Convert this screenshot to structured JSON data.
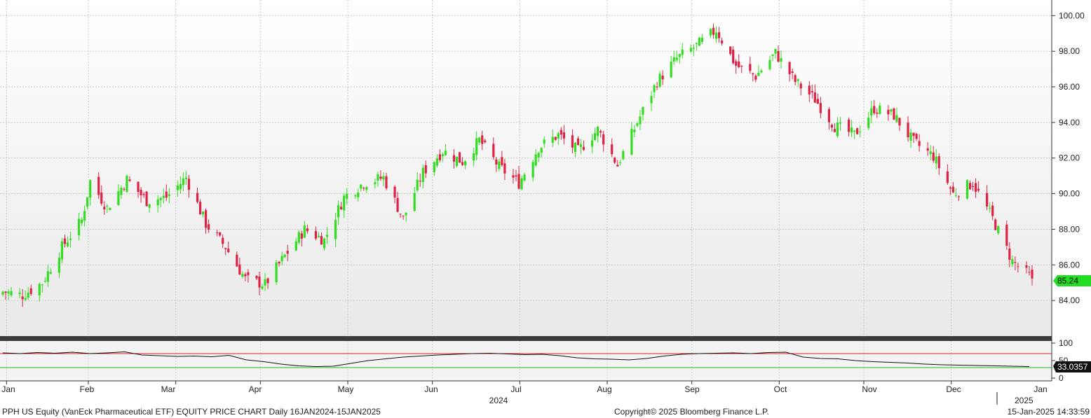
{
  "chart_data": {
    "type": "candlestick",
    "title": "PPH US Equity (VanEck Pharmaceutical ETF) EQUITY PRICE CHART  Daily 16JAN2024-15JAN2025",
    "frequency": "Daily",
    "period": "16JAN2024-15JAN2025",
    "year_label": "2024",
    "year_label_2": "2025",
    "x_tick_labels": [
      "Jan",
      "Feb",
      "Mar",
      "Apr",
      "May",
      "Jun",
      "Jul",
      "Aug",
      "Sep",
      "Oct",
      "Nov",
      "Dec",
      "Jan"
    ],
    "price_panel": {
      "ylim": [
        82.0,
        100.8
      ],
      "y_ticks": [
        "84.00",
        "86.00",
        "88.00",
        "90.00",
        "92.00",
        "94.00",
        "96.00",
        "98.00",
        "100.00"
      ],
      "last_price_label": "85.24",
      "last_price": 85.24,
      "grid": true,
      "up_color": "#33dd22",
      "down_color": "#dd2244",
      "series": [
        {
          "date": "2024-01-16",
          "close": 84.5
        },
        {
          "date": "2024-01-23",
          "close": 84.3
        },
        {
          "date": "2024-01-30",
          "close": 85.0
        },
        {
          "date": "2024-02-06",
          "close": 87.0
        },
        {
          "date": "2024-02-13",
          "close": 88.5
        },
        {
          "date": "2024-02-16",
          "close": 90.7
        },
        {
          "date": "2024-02-22",
          "close": 89.2
        },
        {
          "date": "2024-02-29",
          "close": 90.8
        },
        {
          "date": "2024-03-07",
          "close": 89.6
        },
        {
          "date": "2024-03-14",
          "close": 89.8
        },
        {
          "date": "2024-03-21",
          "close": 90.9
        },
        {
          "date": "2024-03-28",
          "close": 88.3
        },
        {
          "date": "2024-04-04",
          "close": 87.0
        },
        {
          "date": "2024-04-11",
          "close": 85.2
        },
        {
          "date": "2024-04-18",
          "close": 84.9
        },
        {
          "date": "2024-04-25",
          "close": 86.5
        },
        {
          "date": "2024-05-02",
          "close": 88.0
        },
        {
          "date": "2024-05-09",
          "close": 87.4
        },
        {
          "date": "2024-05-16",
          "close": 89.8
        },
        {
          "date": "2024-05-23",
          "close": 90.6
        },
        {
          "date": "2024-05-30",
          "close": 90.9
        },
        {
          "date": "2024-06-06",
          "close": 88.6
        },
        {
          "date": "2024-06-13",
          "close": 91.2
        },
        {
          "date": "2024-06-20",
          "close": 92.4
        },
        {
          "date": "2024-06-27",
          "close": 91.8
        },
        {
          "date": "2024-07-03",
          "close": 93.0
        },
        {
          "date": "2024-07-10",
          "close": 91.5
        },
        {
          "date": "2024-07-17",
          "close": 90.6
        },
        {
          "date": "2024-07-24",
          "close": 92.6
        },
        {
          "date": "2024-07-31",
          "close": 93.3
        },
        {
          "date": "2024-08-07",
          "close": 92.4
        },
        {
          "date": "2024-08-14",
          "close": 93.6
        },
        {
          "date": "2024-08-21",
          "close": 91.6
        },
        {
          "date": "2024-08-28",
          "close": 94.0
        },
        {
          "date": "2024-09-04",
          "close": 96.3
        },
        {
          "date": "2024-09-11",
          "close": 97.6
        },
        {
          "date": "2024-09-18",
          "close": 98.3
        },
        {
          "date": "2024-09-25",
          "close": 99.2
        },
        {
          "date": "2024-10-02",
          "close": 97.2
        },
        {
          "date": "2024-10-09",
          "close": 96.6
        },
        {
          "date": "2024-10-16",
          "close": 97.9
        },
        {
          "date": "2024-10-23",
          "close": 96.3
        },
        {
          "date": "2024-10-30",
          "close": 95.3
        },
        {
          "date": "2024-11-06",
          "close": 93.8
        },
        {
          "date": "2024-11-13",
          "close": 93.3
        },
        {
          "date": "2024-11-20",
          "close": 94.8
        },
        {
          "date": "2024-11-27",
          "close": 94.4
        },
        {
          "date": "2024-12-04",
          "close": 92.9
        },
        {
          "date": "2024-12-11",
          "close": 92.1
        },
        {
          "date": "2024-12-18",
          "close": 90.0
        },
        {
          "date": "2024-12-25",
          "close": 90.6
        },
        {
          "date": "2025-01-01",
          "close": 88.6
        },
        {
          "date": "2025-01-08",
          "close": 86.2
        },
        {
          "date": "2025-01-15",
          "close": 85.24
        }
      ]
    },
    "rsi_panel": {
      "ylim": [
        0,
        100
      ],
      "y_ticks": [
        "0",
        "50",
        "100"
      ],
      "upper_line": 70,
      "lower_line": 30,
      "upper_color": "#dd2222",
      "lower_color": "#22bb22",
      "last_value_label": "33.0357",
      "last_value": 33.0357,
      "series": [
        72,
        70,
        73,
        71,
        74,
        70,
        72,
        75,
        66,
        64,
        62,
        63,
        61,
        65,
        52,
        47,
        40,
        35,
        33,
        34,
        42,
        50,
        55,
        60,
        63,
        66,
        68,
        70,
        71,
        69,
        67,
        68,
        64,
        58,
        55,
        54,
        52,
        56,
        63,
        68,
        70,
        71,
        72,
        70,
        73,
        74,
        60,
        56,
        55,
        50,
        47,
        45,
        43,
        40,
        38,
        37,
        36,
        35,
        34,
        33.0357
      ]
    },
    "copyright": "Copyright© 2025 Bloomberg Finance L.P.",
    "timestamp": "15-Jan-2025 14:33:59"
  }
}
